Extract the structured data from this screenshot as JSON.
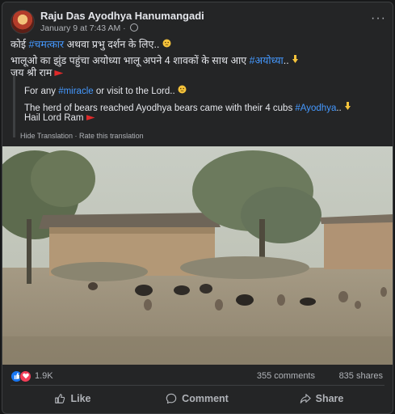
{
  "post": {
    "author": "Raju Das Ayodhya Hanumangadi",
    "date": "January 9 at 7:43 AM",
    "meta_sep": " · ",
    "more": "···",
    "line1_before": "कोई ",
    "line1_hash": "#चमत्कार",
    "line1_after": " अथवा प्रभु दर्शन के लिए..",
    "line2_before": "भालूओ का झुंड पहुंचा अयोध्या भालू अपने 4 शावकों के साथ आए ",
    "line2_hash": "#अयोध्या",
    "line2_after": "..",
    "line3": "जय श्री राम"
  },
  "translation": {
    "line1_before": "For any ",
    "line1_hash": "#miracle",
    "line1_after": " or visit to the Lord..",
    "line2_before": "The herd of bears reached Ayodhya bears came with their 4 cubs ",
    "line2_hash": "#Ayodhya",
    "line2_after": "..",
    "line3": "Hail Lord Ram",
    "hide_link": "Hide Translation",
    "link_sep": " · ",
    "rate_link": "Rate this translation"
  },
  "stats": {
    "reactions": "1.9K",
    "comments": "355 comments",
    "shares": "835 shares"
  },
  "actions": {
    "like": "Like",
    "comment": "Comment",
    "share": "Share"
  },
  "colors": {
    "background": "#18191a",
    "card": "#242526",
    "hashtag": "#4599ff",
    "like_blue": "#1877f2",
    "love_red": "#f33e58"
  },
  "icons": [
    "avatar",
    "globe-icon",
    "more-options-icon",
    "thinking-emoji",
    "pointing-down-emoji",
    "flag-icon",
    "like-reaction-icon",
    "love-reaction-icon",
    "thumbs-up-icon",
    "comment-icon",
    "share-icon"
  ]
}
